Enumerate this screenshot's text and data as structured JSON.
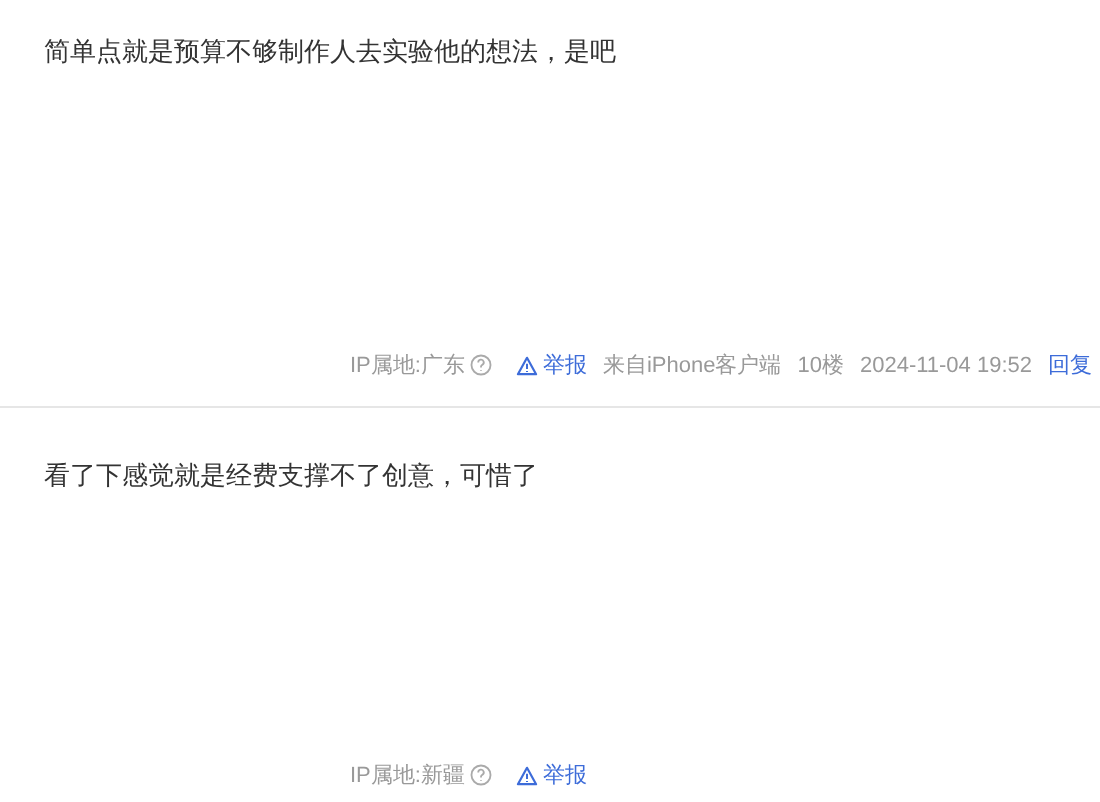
{
  "posts": [
    {
      "content": "简单点就是预算不够制作人去实验他的想法，是吧",
      "ip": "IP属地:广东",
      "report": "举报",
      "source": "来自iPhone客户端",
      "floor": "10楼",
      "time": "2024-11-04 19:52",
      "reply": "回复"
    },
    {
      "content": "看了下感觉就是经费支撑不了创意，可惜了",
      "ip": "IP属地:新疆",
      "report": "举报"
    }
  ]
}
